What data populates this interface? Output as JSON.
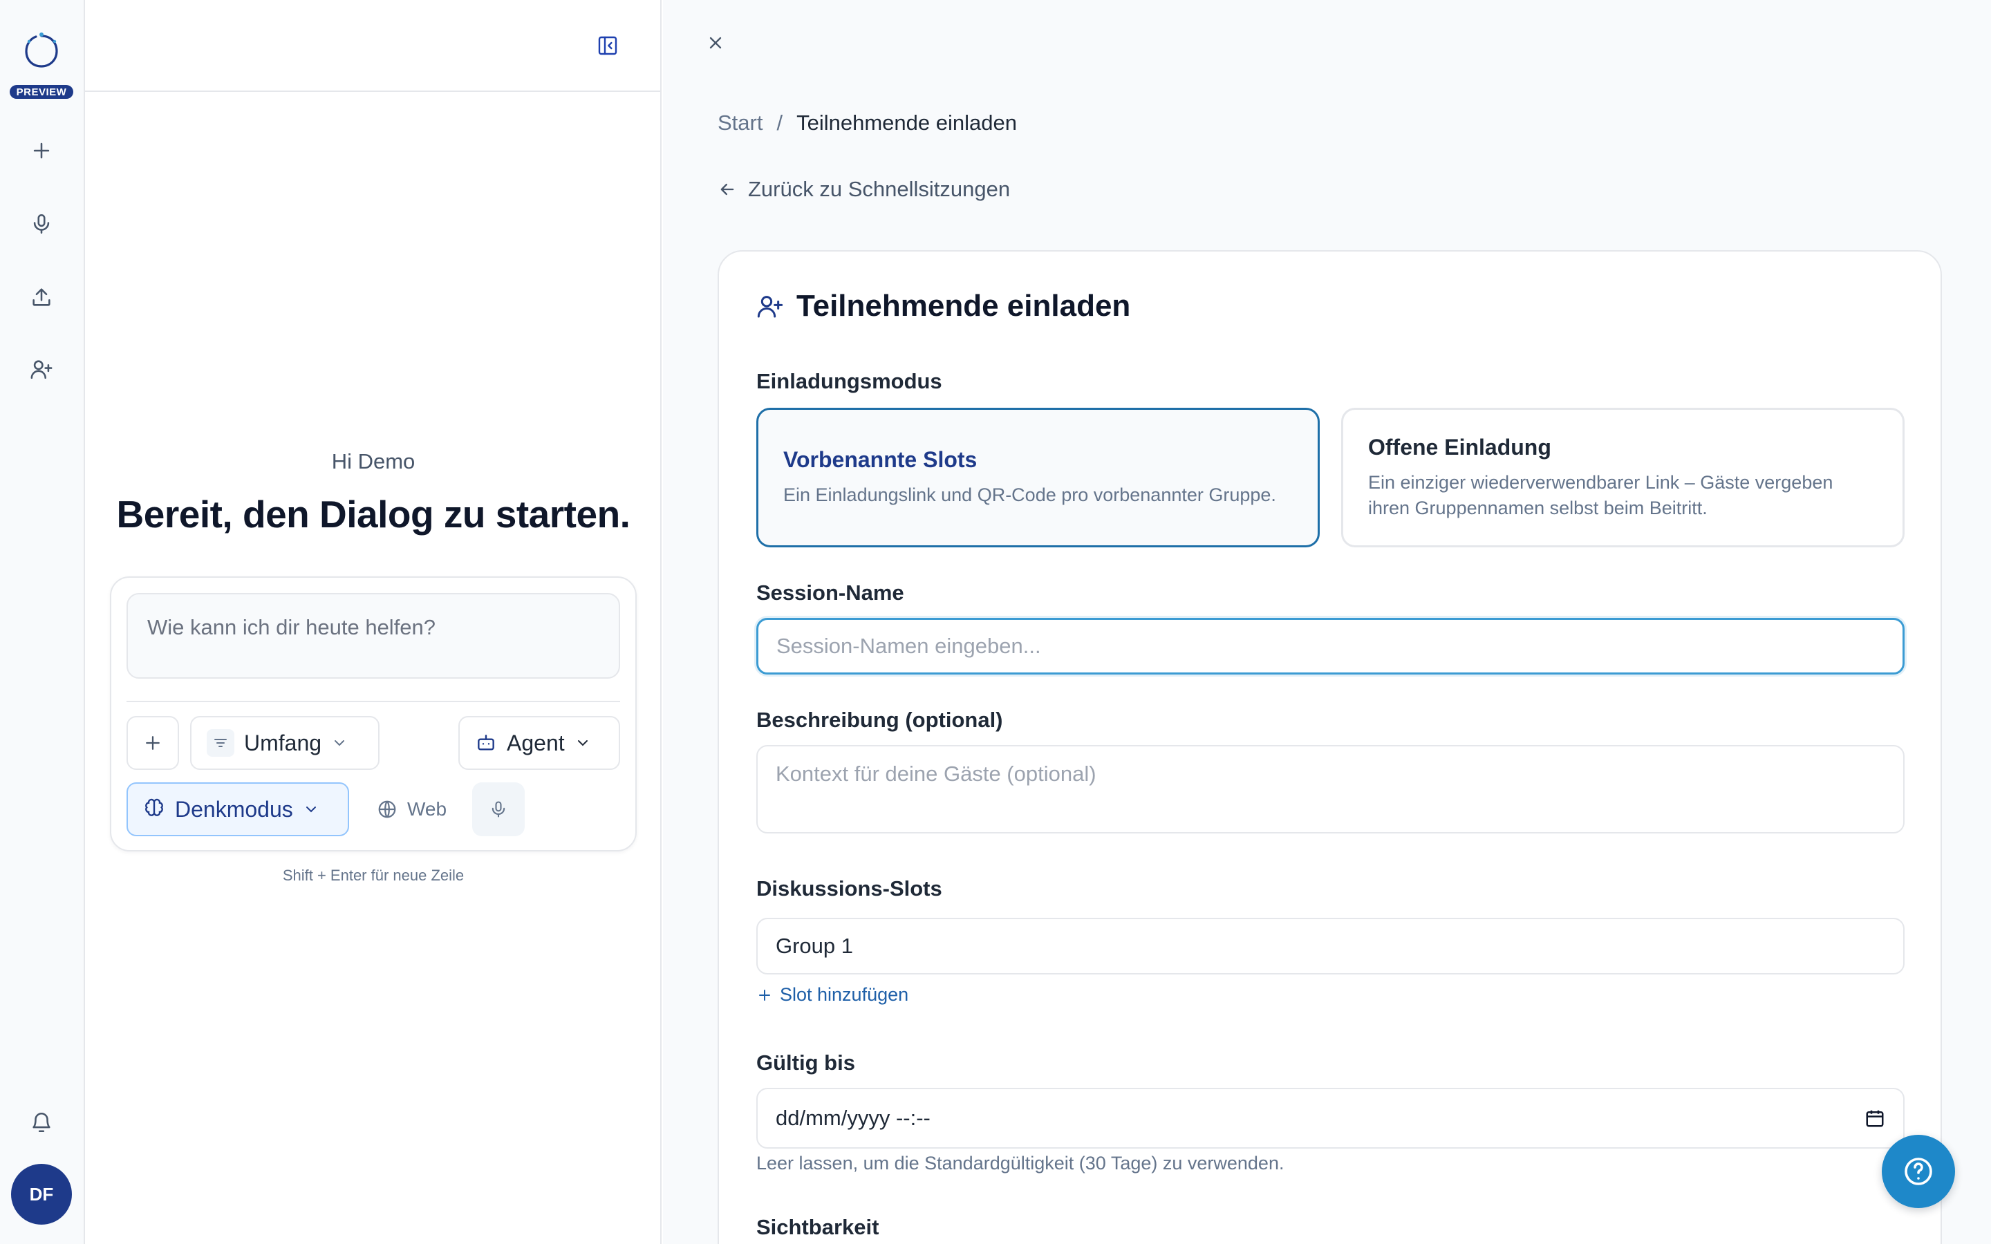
{
  "rail": {
    "badge": "PREVIEW",
    "avatar_initials": "DF",
    "items": [
      {
        "icon": "plus-icon"
      },
      {
        "icon": "microphone-icon"
      },
      {
        "icon": "upload-icon"
      },
      {
        "icon": "user-plus-icon"
      },
      {
        "icon": "bell-icon"
      }
    ]
  },
  "chat": {
    "greeting": "Hi Demo",
    "headline": "Bereit, den Dialog zu starten.",
    "composer": {
      "placeholder": "Wie kann ich dir heute helfen?",
      "scope_label": "Umfang",
      "agent_label": "Agent",
      "thinking_label": "Denkmodus",
      "web_label": "Web"
    },
    "hint": "Shift + Enter für neue Zeile"
  },
  "main": {
    "breadcrumb": {
      "root": "Start",
      "separator": "/",
      "current": "Teilnehmende einladen"
    },
    "back_link": "Zurück zu Schnellsitzungen",
    "card": {
      "title": "Teilnehmende einladen",
      "mode_label": "Einladungsmodus",
      "modes": [
        {
          "title": "Vorbenannte Slots",
          "description": "Ein Einladungslink und QR-Code pro vorbenannter Gruppe.",
          "selected": true
        },
        {
          "title": "Offene Einladung",
          "description": "Ein einziger wiederverwendbarer Link – Gäste vergeben ihren Gruppennamen selbst beim Beitritt.",
          "selected": false
        }
      ],
      "session_name_label": "Session-Name",
      "session_name_placeholder": "Session-Namen eingeben...",
      "description_label": "Beschreibung (optional)",
      "description_placeholder": "Kontext für deine Gäste (optional)",
      "slots_label": "Diskussions-Slots",
      "slots": [
        "Group 1"
      ],
      "add_slot_label": "Slot hinzufügen",
      "valid_until_label": "Gültig bis",
      "valid_until_placeholder": "dd/mm/yyyy --:--",
      "valid_until_hint": "Leer lassen, um die Standardgültigkeit (30 Tage) zu verwenden.",
      "visibility_label": "Sichtbarkeit"
    }
  },
  "colors": {
    "brand": "#1e3a8a",
    "accent": "#1e88c9",
    "focus": "#3b9bd3"
  }
}
